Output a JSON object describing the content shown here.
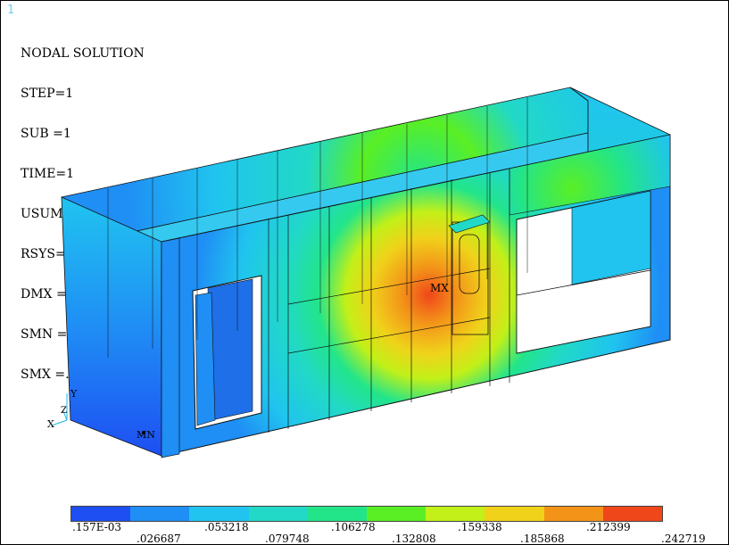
{
  "window_number": "1",
  "info": {
    "title": "NODAL SOLUTION",
    "lines": [
      "STEP=1",
      "SUB =1",
      "TIME=1",
      "USUM      (AVG)",
      "RSYS=0",
      "DMX =.242719",
      "SMN =.157E-03",
      "SMX =.242719"
    ]
  },
  "markers": {
    "max": "MX",
    "min": "MN"
  },
  "triad": {
    "x": "X",
    "y": "Y",
    "z": "Z"
  },
  "legend": {
    "colors": [
      "#1e4ff2",
      "#1f8ef5",
      "#20c4ef",
      "#21d9c6",
      "#22e58a",
      "#5aef24",
      "#c2f018",
      "#f0d21a",
      "#f39419",
      "#f0471a"
    ],
    "labels_bottom": [
      ".157E-03",
      ".053218",
      ".106278",
      ".159338",
      ".212399"
    ],
    "labels_top": [
      ".026687",
      ".079748",
      ".132808",
      ".185868",
      ".242719"
    ]
  }
}
